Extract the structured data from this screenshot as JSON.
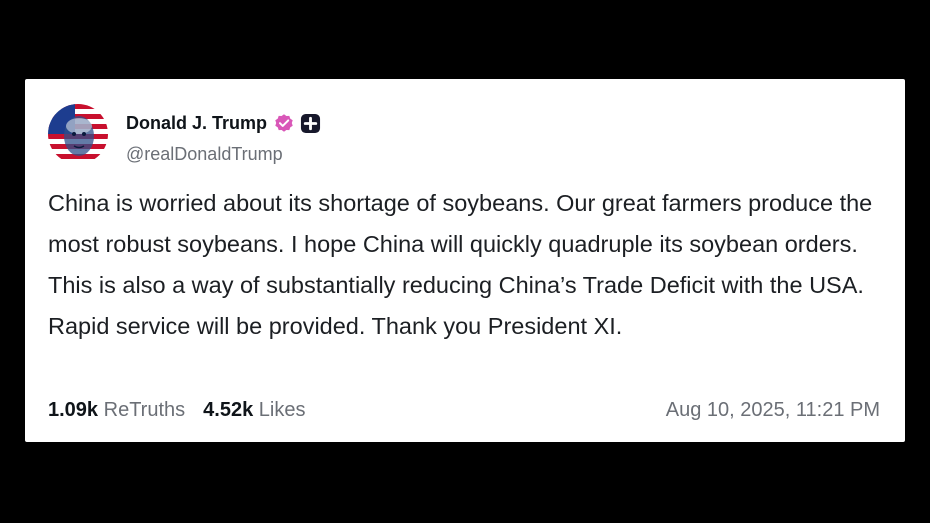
{
  "post": {
    "author_name": "Donald J. Trump",
    "handle": "@realDonaldTrump",
    "avatar_icon": "avatar-portrait-flag",
    "verified_icon": "verified-badge-icon",
    "plus_icon": "plus-badge-icon",
    "text": "China is worried about its shortage of soybeans. Our great farmers produce the most robust soybeans. I hope China will quickly quadruple its soybean orders. This is also a way of substantially reducing China’s Trade Deficit with the USA. Rapid service will be provided. Thank you President XI.",
    "retruths_count": "1.09k",
    "retruths_label": "ReTruths",
    "likes_count": "4.52k",
    "likes_label": "Likes",
    "timestamp": "Aug 10, 2025, 11:21 PM"
  },
  "colors": {
    "verified": "#d957b8",
    "plus_badge": "#17182b",
    "flag_red": "#c8102e",
    "flag_blue": "#1d3d8f"
  }
}
